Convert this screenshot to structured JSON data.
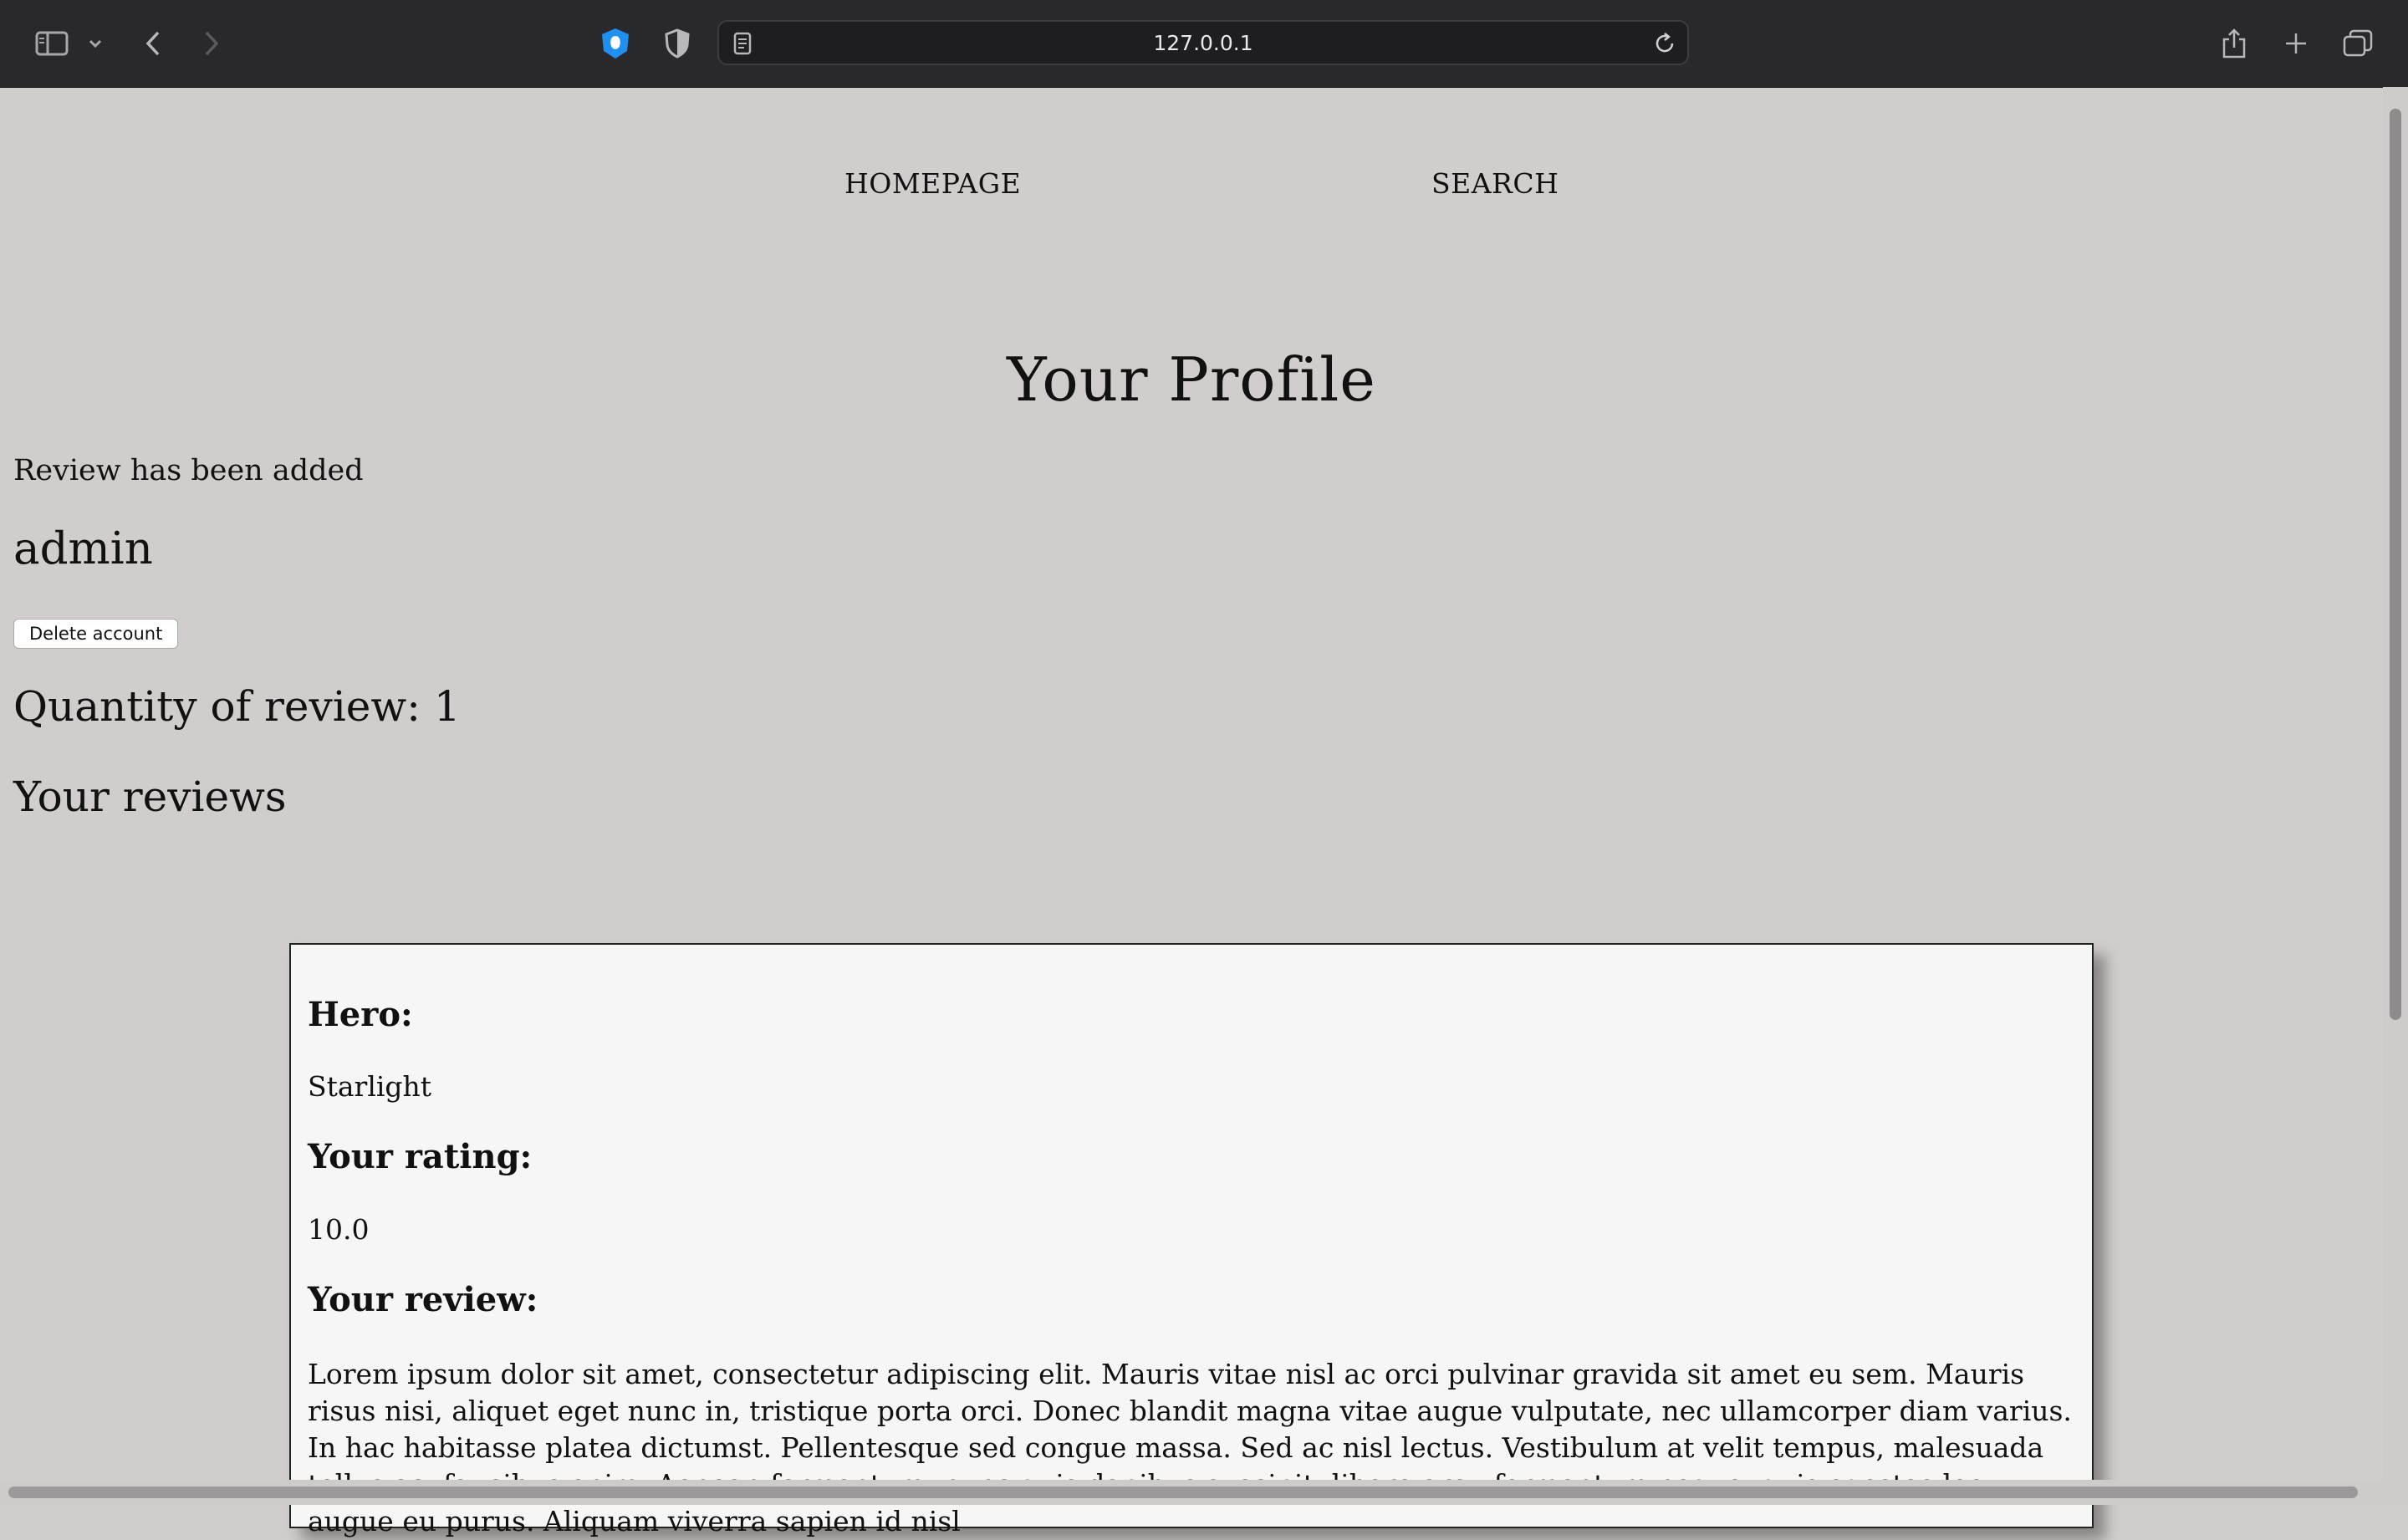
{
  "browser": {
    "url": "127.0.0.1",
    "icons": [
      "sidebar-icon",
      "chevron-down-icon",
      "back-icon",
      "forward-icon",
      "extension-icon",
      "shield-icon",
      "page-icon",
      "reload-icon",
      "share-icon",
      "new-tab-icon",
      "tabs-overview-icon"
    ]
  },
  "nav": {
    "home_label": "HOMEPAGE",
    "search_label": "SEARCH"
  },
  "profile": {
    "title": "Your Profile",
    "message": "Review has been added",
    "username": "admin",
    "delete_label": "Delete account",
    "quantity_text": "Quantity of review: 1",
    "reviews_heading": "Your reviews"
  },
  "review": {
    "hero_label": "Hero:",
    "hero_value": "Starlight",
    "rating_label": "Your rating:",
    "rating_value": "10.0",
    "review_label": "Your review:",
    "review_text": "Lorem ipsum dolor sit amet, consectetur adipiscing elit. Mauris vitae nisl ac orci pulvinar gravida sit amet eu sem. Mauris risus nisi, aliquet eget nunc in, tristique porta orci. Donec blandit magna vitae augue vulputate, nec ullamcorper diam varius. In hac habitasse platea dictumst. Pellentesque sed congue massa. Sed ac nisl lectus. Vestibulum at velit tempus, malesuada tellus ac, faucibus enim. Aenean fermentum, nunc quis dapibus suscipit, libero arcu fermentum neque, quis egestas leo augue eu purus. Aliquam viverra sapien id nisl"
  }
}
